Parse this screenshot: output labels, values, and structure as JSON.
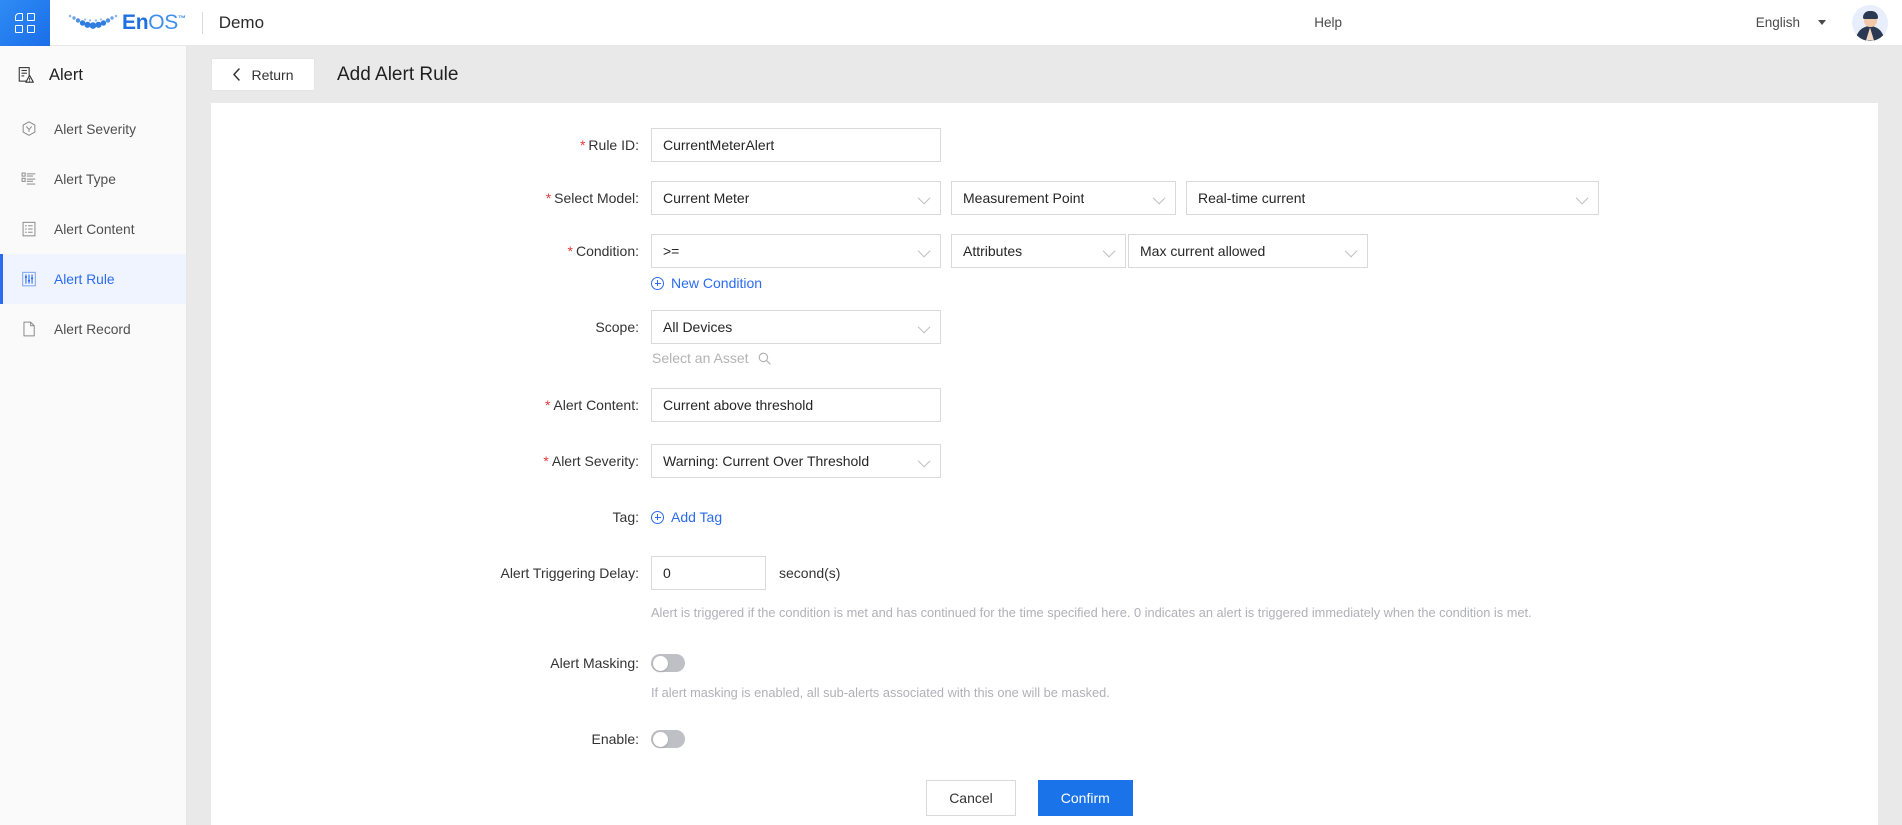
{
  "header": {
    "app_grid_icon": "app-grid-icon",
    "brand_en": "En",
    "brand_os": "OS",
    "brand_tm": "™",
    "workspace": "Demo",
    "help_label": "Help",
    "language_label": "English",
    "avatar_icon": "user-avatar"
  },
  "sidebar": {
    "section_title": "Alert",
    "section_icon": "alert-document-icon",
    "items": [
      {
        "label": "Alert Severity",
        "icon": "severity-icon",
        "active": false
      },
      {
        "label": "Alert Type",
        "icon": "list-icon",
        "active": false
      },
      {
        "label": "Alert Content",
        "icon": "clipboard-icon",
        "active": false
      },
      {
        "label": "Alert Rule",
        "icon": "sliders-icon",
        "active": true
      },
      {
        "label": "Alert Record",
        "icon": "file-icon",
        "active": false
      }
    ]
  },
  "page": {
    "return_label": "Return",
    "return_icon": "chevron-left-icon",
    "title": "Add Alert Rule"
  },
  "form": {
    "rule_id": {
      "label": "Rule ID:",
      "required": true,
      "value": "CurrentMeterAlert"
    },
    "select_model": {
      "label": "Select Model:",
      "required": true,
      "model": "Current Meter",
      "point_type": "Measurement Point",
      "point": "Real-time current"
    },
    "condition": {
      "label": "Condition:",
      "required": true,
      "operator": ">=",
      "source": "Attributes",
      "target": "Max current allowed",
      "new_condition_label": "New Condition",
      "new_condition_icon": "plus-circle-icon"
    },
    "scope": {
      "label": "Scope:",
      "required": false,
      "value": "All Devices",
      "asset_placeholder": "Select an Asset",
      "asset_icon": "search-icon"
    },
    "alert_content": {
      "label": "Alert Content:",
      "required": true,
      "value": "Current above threshold"
    },
    "alert_severity": {
      "label": "Alert Severity:",
      "required": true,
      "value": "Warning: Current Over Threshold"
    },
    "tag": {
      "label": "Tag:",
      "add_label": "Add Tag",
      "add_icon": "plus-circle-icon"
    },
    "trigger_delay": {
      "label": "Alert Triggering Delay:",
      "value": "0",
      "unit": "second(s)",
      "helper": "Alert is triggered if the condition is met and has continued for the time specified here. 0 indicates an alert is triggered immediately when the condition is met."
    },
    "alert_masking": {
      "label": "Alert Masking:",
      "enabled": false,
      "helper": "If alert masking is enabled, all sub-alerts associated with this one will be masked."
    },
    "enable": {
      "label": "Enable:",
      "enabled": false
    },
    "actions": {
      "cancel_label": "Cancel",
      "confirm_label": "Confirm"
    }
  },
  "colors": {
    "accent": "#2a6bf2",
    "confirm": "#1a73e8",
    "required": "#e4393c",
    "sidebar_active_bg": "#f0f4ff"
  }
}
